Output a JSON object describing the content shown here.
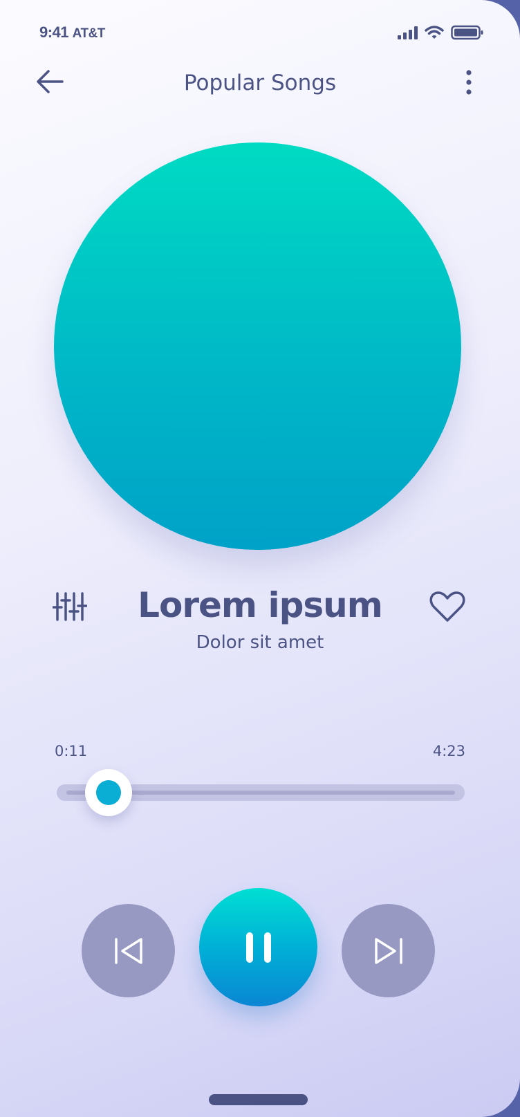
{
  "status_bar": {
    "time": "9:41",
    "carrier": "AT&T"
  },
  "header": {
    "title": "Popular Songs",
    "back_icon": "arrow-left-icon",
    "menu_icon": "more-vertical-icon"
  },
  "now_playing": {
    "title": "Lorem ipsum",
    "artist": "Dolor sit amet",
    "favorited": false
  },
  "progress": {
    "elapsed": "0:11",
    "total": "4:23",
    "fraction": 0.042
  },
  "controls": {
    "previous_icon": "skip-previous-icon",
    "play_pause_icon": "pause-icon",
    "next_icon": "skip-next-icon",
    "equalizer_icon": "equalizer-sliders-icon",
    "favorite_icon": "heart-outline-icon"
  },
  "colors": {
    "text": "#4b5384",
    "accent": "#00b8c7",
    "control_inactive": "#9799c2",
    "progress_thumb": "#0aaed4"
  }
}
